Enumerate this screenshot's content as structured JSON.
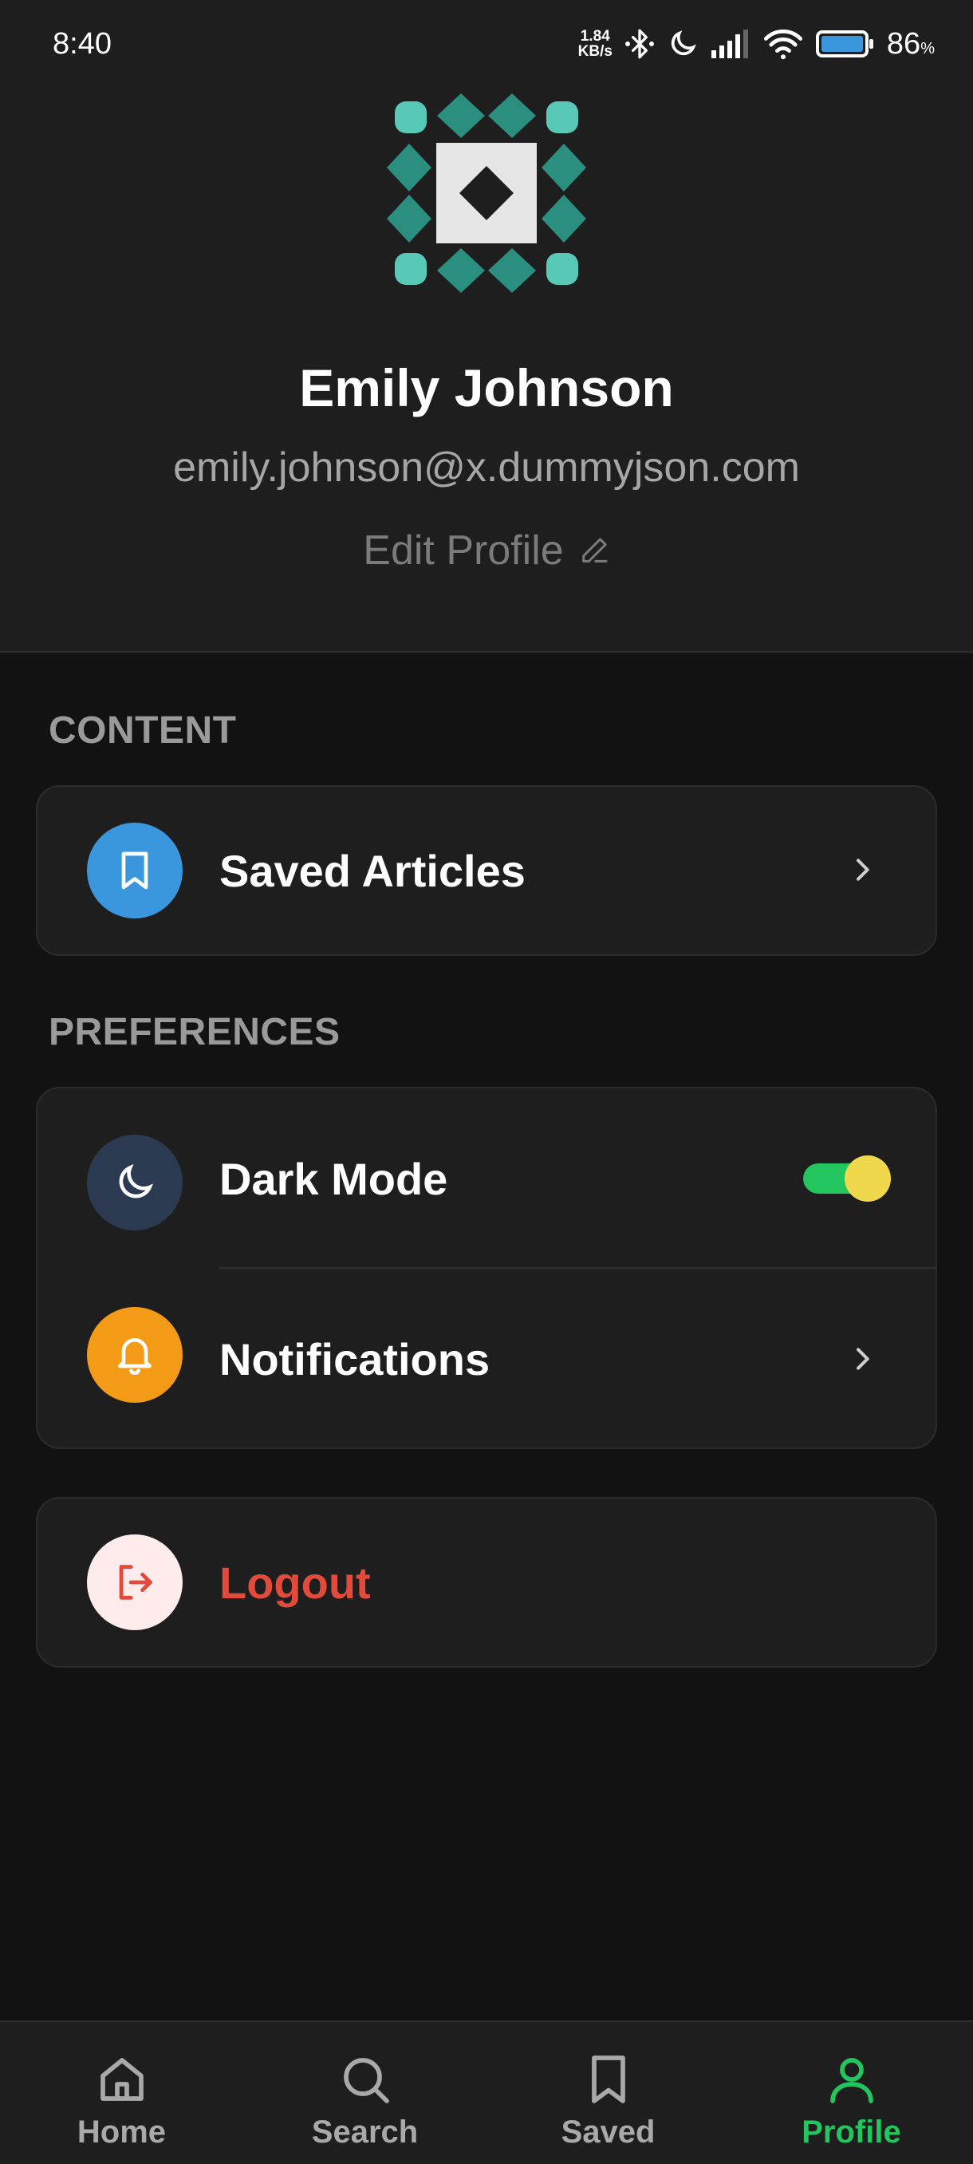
{
  "status_bar": {
    "time": "8:40",
    "net_speed_value": "1.84",
    "net_speed_unit": "KB/s",
    "battery_percent": "86",
    "battery_symbol": "%",
    "icons": [
      "bluetooth-icon",
      "moon-icon",
      "signal-icon",
      "wifi-icon",
      "battery-icon"
    ]
  },
  "profile": {
    "name": "Emily Johnson",
    "email": "emily.johnson@x.dummyjson.com",
    "edit_label": "Edit Profile"
  },
  "sections": {
    "content_title": "CONTENT",
    "preferences_title": "PREFERENCES"
  },
  "menu": {
    "saved_articles": "Saved Articles",
    "dark_mode": "Dark Mode",
    "dark_mode_enabled": true,
    "notifications": "Notifications",
    "logout": "Logout"
  },
  "nav": {
    "items": [
      {
        "label": "Home",
        "icon": "home-icon"
      },
      {
        "label": "Search",
        "icon": "search-icon"
      },
      {
        "label": "Saved",
        "icon": "bookmark-icon"
      },
      {
        "label": "Profile",
        "icon": "user-icon",
        "active": true
      }
    ]
  },
  "colors": {
    "accent_green": "#22c55e",
    "blue": "#3a97de",
    "orange": "#f39a17",
    "logout_red": "#e24b3b",
    "dark_mode_icon_bg": "#2b3a50",
    "avatar_teal": "#2b8f80",
    "avatar_light_teal": "#58c9b6"
  }
}
